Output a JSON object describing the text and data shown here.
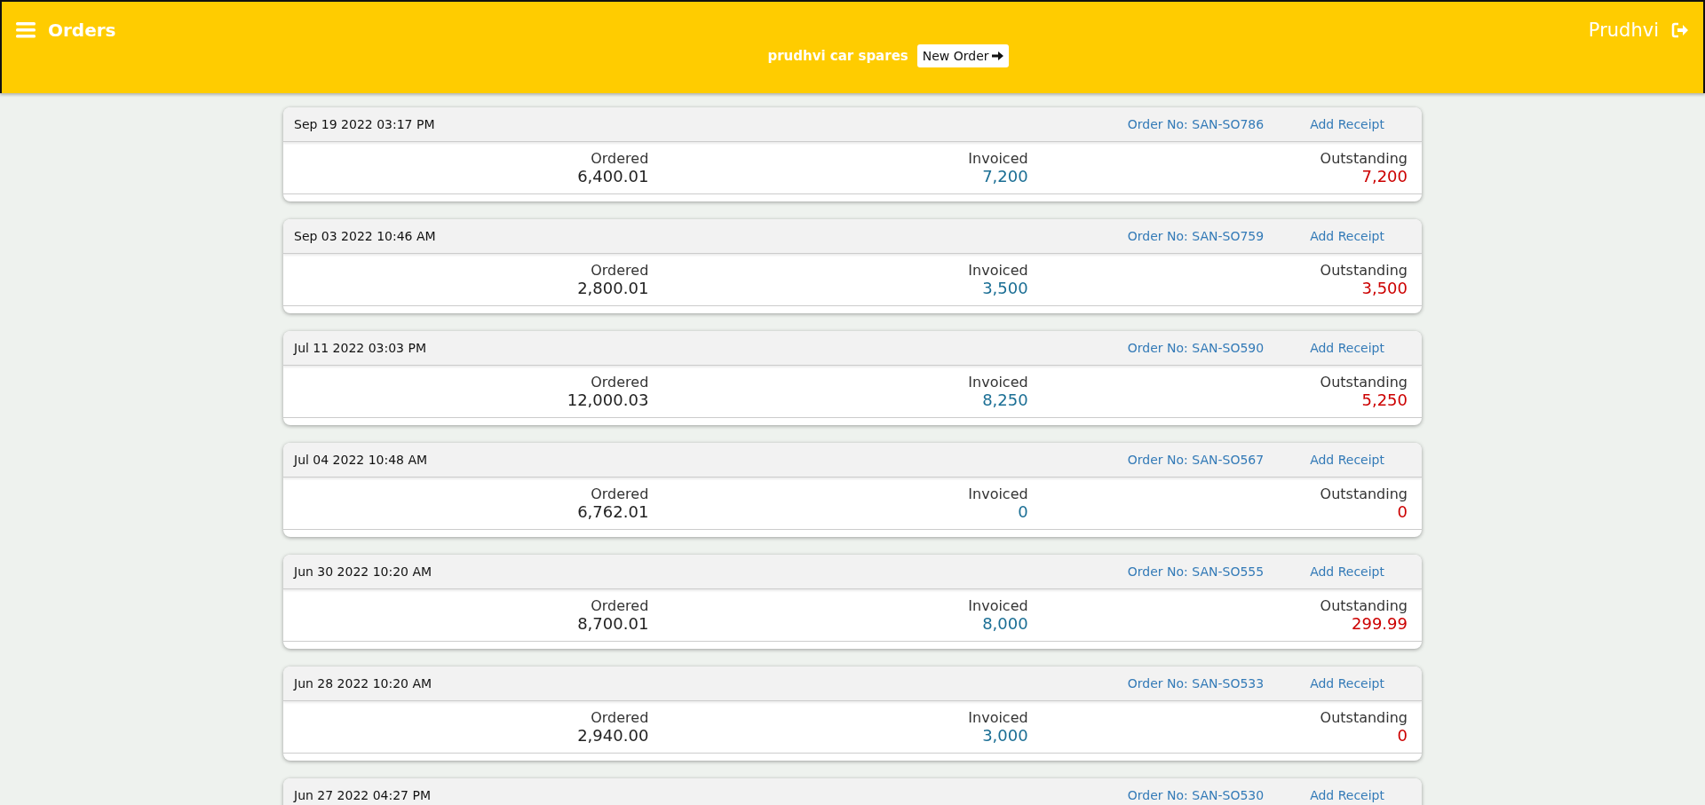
{
  "header": {
    "title": "Orders",
    "user": "Prudhvi",
    "company": "prudhvi car spares",
    "new_order_button": "New Order"
  },
  "orders": [
    {
      "date": "Sep 19 2022 03:17 PM",
      "order_no": "Order No: SAN-SO786",
      "action": "Add Receipt",
      "ordered_label": "Ordered",
      "ordered": "6,400.01",
      "invoiced_label": "Invoiced",
      "invoiced": "7,200",
      "outstanding_label": "Outstanding",
      "outstanding": "7,200"
    },
    {
      "date": "Sep 03 2022 10:46 AM",
      "order_no": "Order No: SAN-SO759",
      "action": "Add Receipt",
      "ordered_label": "Ordered",
      "ordered": "2,800.01",
      "invoiced_label": "Invoiced",
      "invoiced": "3,500",
      "outstanding_label": "Outstanding",
      "outstanding": "3,500"
    },
    {
      "date": "Jul 11 2022 03:03 PM",
      "order_no": "Order No: SAN-SO590",
      "action": "Add Receipt",
      "ordered_label": "Ordered",
      "ordered": "12,000.03",
      "invoiced_label": "Invoiced",
      "invoiced": "8,250",
      "outstanding_label": "Outstanding",
      "outstanding": "5,250"
    },
    {
      "date": "Jul 04 2022 10:48 AM",
      "order_no": "Order No: SAN-SO567",
      "action": "Add Receipt",
      "ordered_label": "Ordered",
      "ordered": "6,762.01",
      "invoiced_label": "Invoiced",
      "invoiced": "0",
      "outstanding_label": "Outstanding",
      "outstanding": "0"
    },
    {
      "date": "Jun 30 2022 10:20 AM",
      "order_no": "Order No: SAN-SO555",
      "action": "Add Receipt",
      "ordered_label": "Ordered",
      "ordered": "8,700.01",
      "invoiced_label": "Invoiced",
      "invoiced": "8,000",
      "outstanding_label": "Outstanding",
      "outstanding": "299.99"
    },
    {
      "date": "Jun 28 2022 10:20 AM",
      "order_no": "Order No: SAN-SO533",
      "action": "Add Receipt",
      "ordered_label": "Ordered",
      "ordered": "2,940.00",
      "invoiced_label": "Invoiced",
      "invoiced": "3,000",
      "outstanding_label": "Outstanding",
      "outstanding": "0"
    },
    {
      "date": "Jun 27 2022 04:27 PM",
      "order_no": "Order No: SAN-SO530",
      "action": "Add Receipt"
    }
  ]
}
